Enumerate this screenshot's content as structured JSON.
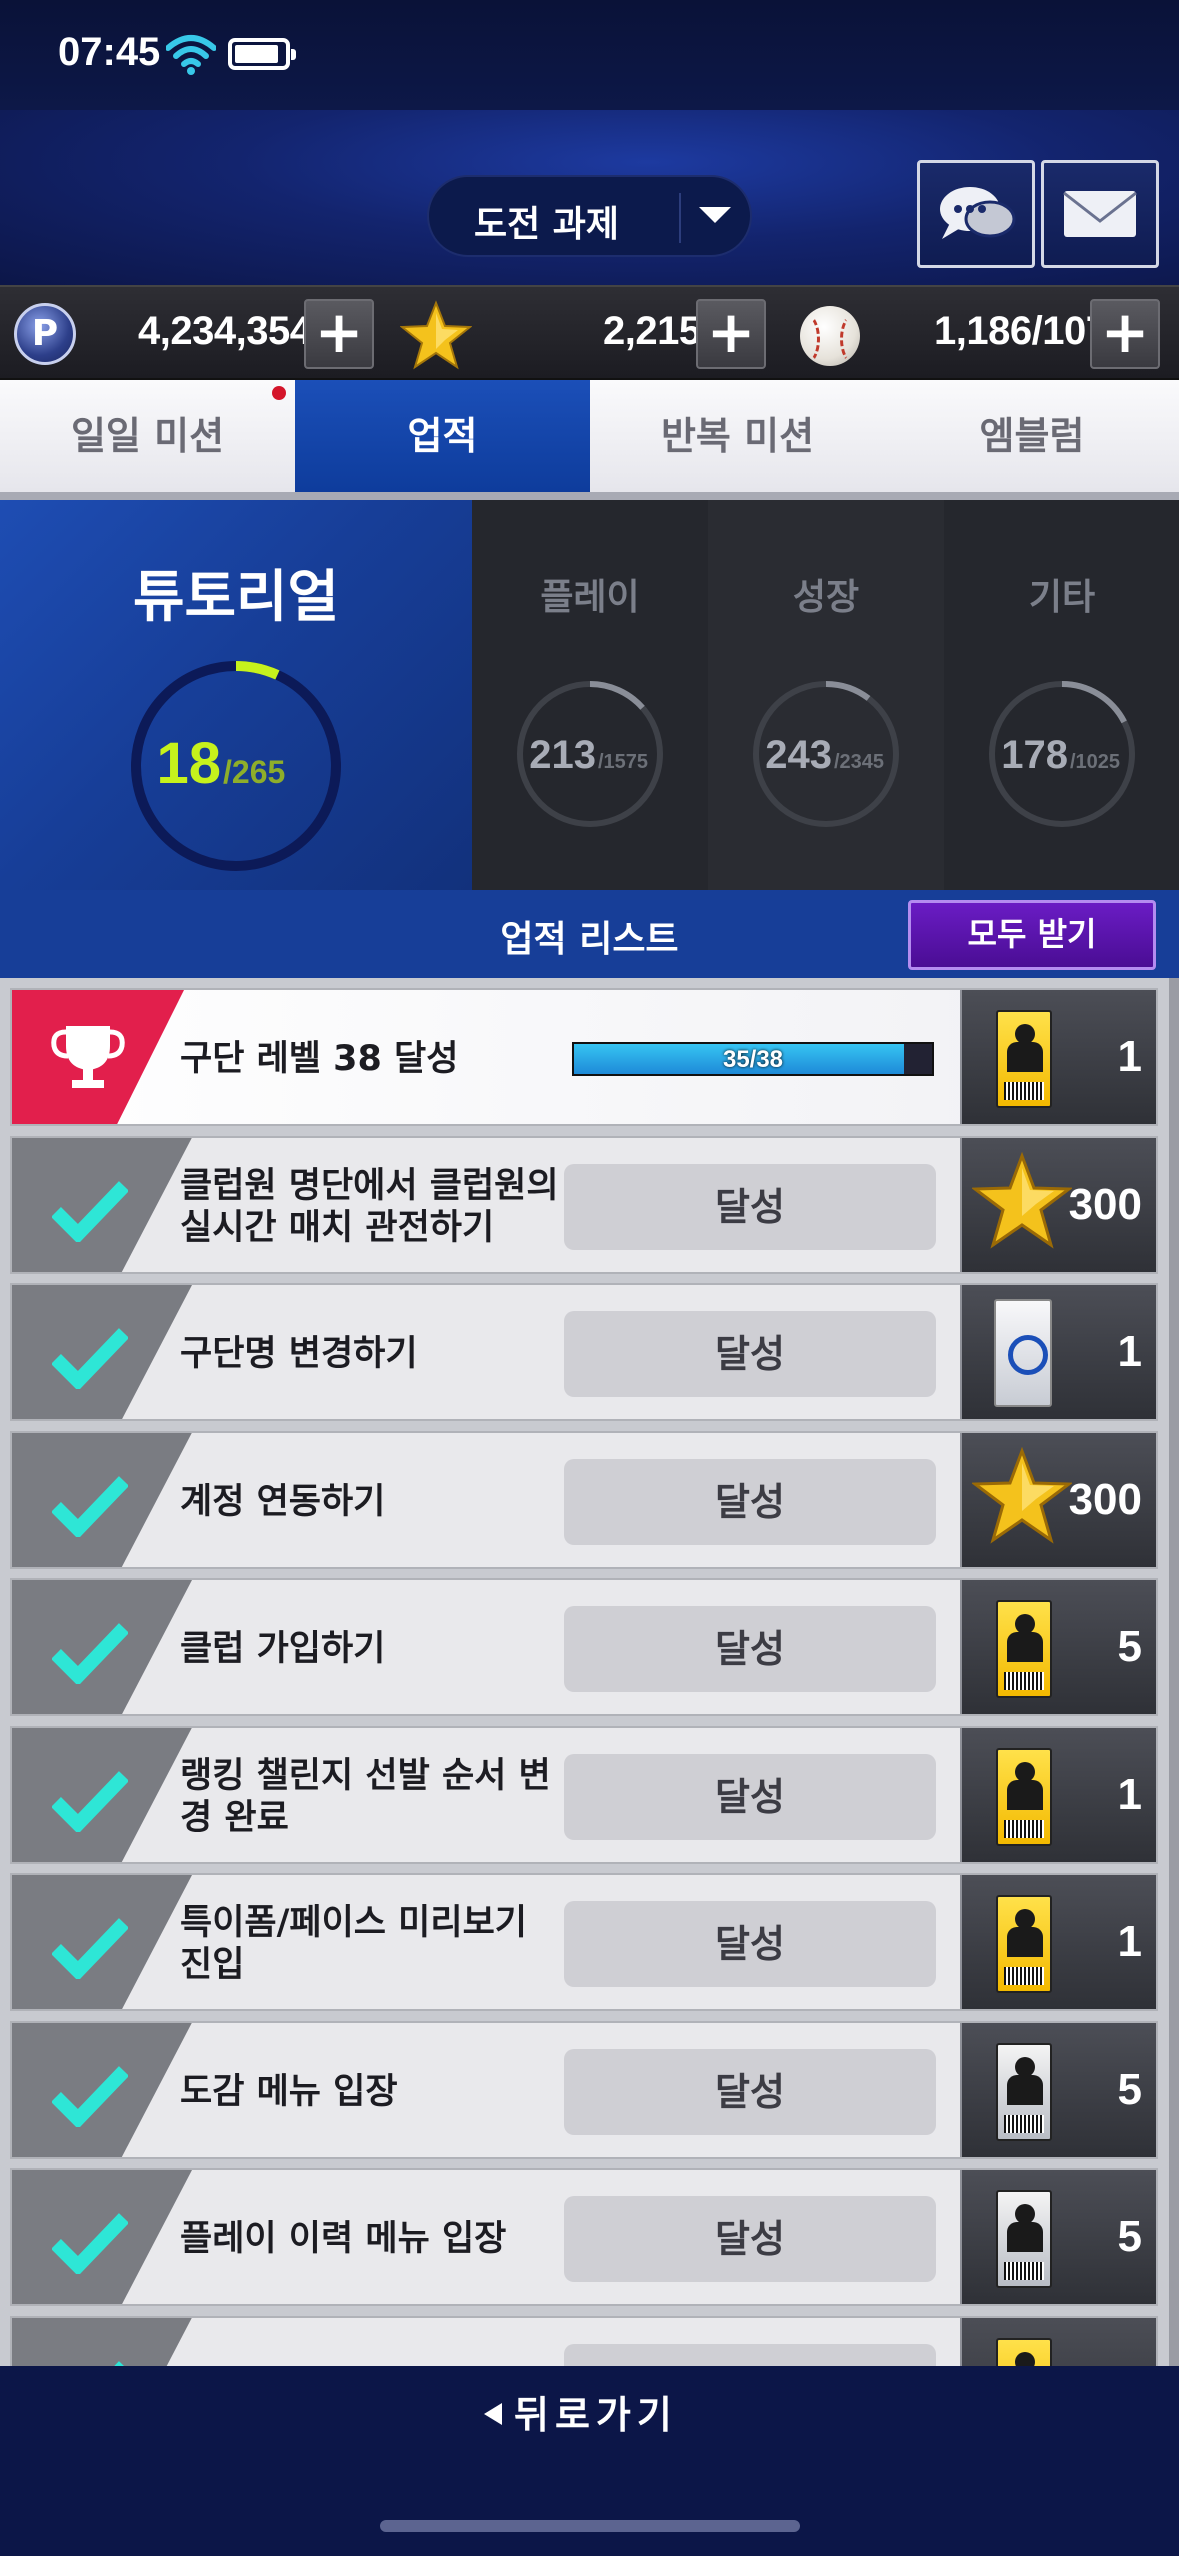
{
  "status_bar": {
    "time": "07:45"
  },
  "header": {
    "title": "도전 과제",
    "chat_icon": "chat-bubbles-icon",
    "mail_icon": "envelope-icon"
  },
  "currency": [
    {
      "icon": "p-coin-icon",
      "value": "4,234,354"
    },
    {
      "icon": "star-icon",
      "value": "2,215"
    },
    {
      "icon": "baseball-icon",
      "value": "1,186/107"
    }
  ],
  "tabs": [
    {
      "label": "일일 미션",
      "active": false,
      "has_notification": true
    },
    {
      "label": "업적",
      "active": true
    },
    {
      "label": "반복 미션",
      "active": false
    },
    {
      "label": "엠블럼",
      "active": false
    }
  ],
  "summary": {
    "tutorial": {
      "title": "튜토리얼",
      "current": "18",
      "total": "/265",
      "progress": 0.068
    },
    "categories": [
      {
        "label": "플레이",
        "current": "213",
        "total": "/1575",
        "progress": 0.135
      },
      {
        "label": "성장",
        "current": "243",
        "total": "/2345",
        "progress": 0.104
      },
      {
        "label": "기타",
        "current": "178",
        "total": "/1025",
        "progress": 0.174
      }
    ]
  },
  "list_header": {
    "title": "업적 리스트",
    "claim_all": "모두 받기"
  },
  "achievements": [
    {
      "text": "구단 레벨 38 달성",
      "status": "progress",
      "progress_text": "35/38",
      "progress": 0.921,
      "reward_type": "scout-ticket",
      "reward_qty": "1"
    },
    {
      "text": "클럽원 명단에서 클럽원의 실시간 매치 관전하기",
      "status": "달성",
      "reward_type": "star",
      "reward_qty": "300"
    },
    {
      "text": "구단명 변경하기",
      "status": "달성",
      "reward_type": "player-pack",
      "reward_qty": "1"
    },
    {
      "text": "계정 연동하기",
      "status": "달성",
      "reward_type": "star",
      "reward_qty": "300"
    },
    {
      "text": "클럽 가입하기",
      "status": "달성",
      "reward_type": "scout-ticket",
      "reward_qty": "5"
    },
    {
      "text": "랭킹 챌린지 선발 순서 변경 완료",
      "status": "달성",
      "reward_type": "scout-ticket",
      "reward_qty": "1"
    },
    {
      "text": "특이폼/페이스 미리보기 진입",
      "status": "달성",
      "reward_type": "scout-ticket",
      "reward_qty": "1"
    },
    {
      "text": "도감 메뉴 입장",
      "status": "달성",
      "reward_type": "silver-scout-ticket",
      "reward_qty": "5"
    },
    {
      "text": "플레이 이력 메뉴 입장",
      "status": "달성",
      "reward_type": "silver-scout-ticket",
      "reward_qty": "5"
    },
    {
      "text": "",
      "status": "",
      "reward_type": "scout-ticket",
      "reward_qty": ""
    }
  ],
  "bottom": {
    "back_label": "뒤로가기"
  },
  "colors": {
    "accent_blue": "#1b4fb8",
    "claim_purple": "#5a14ac",
    "check_cyan": "#2ee6d6",
    "trophy_red": "#e21f4c"
  }
}
